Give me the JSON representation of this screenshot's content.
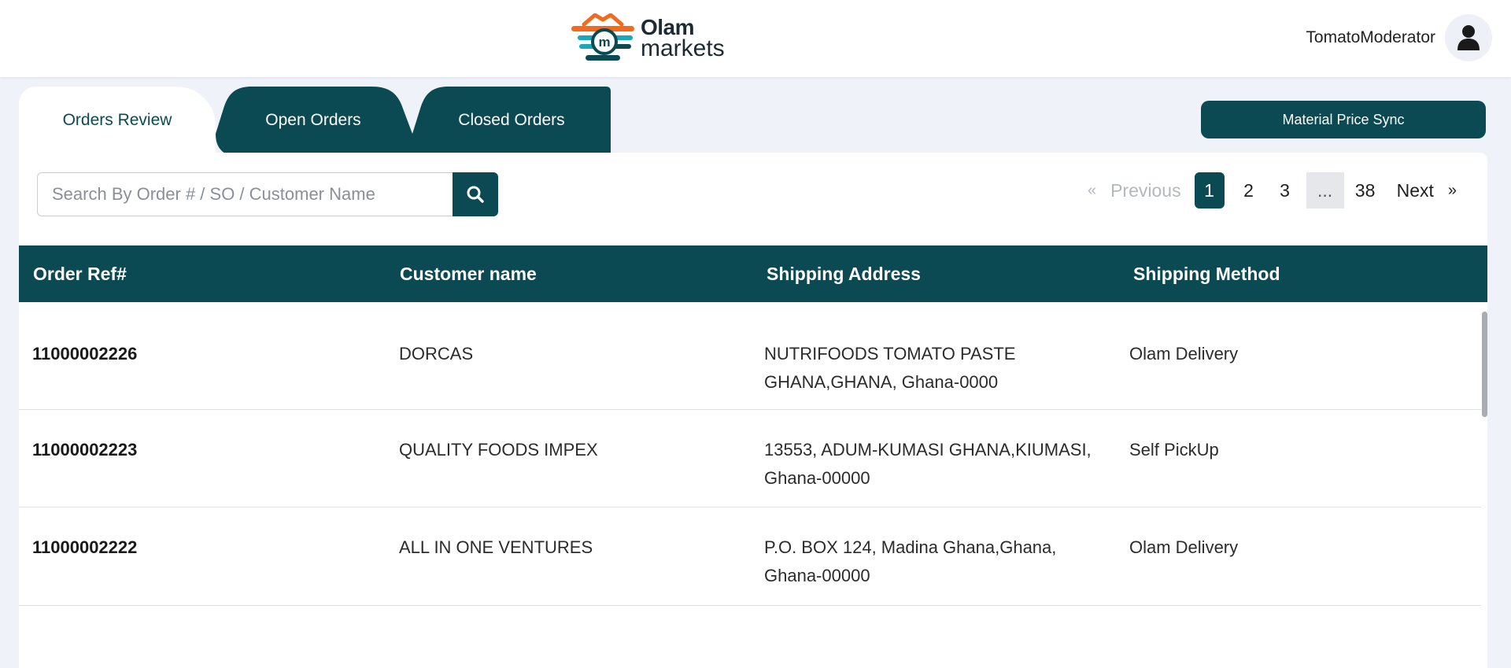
{
  "header": {
    "logo_line1": "Olam",
    "logo_line2": "markets",
    "username": "TomatoModerator"
  },
  "tabs": [
    {
      "label": "Orders Review",
      "active": true
    },
    {
      "label": "Open Orders",
      "active": false
    },
    {
      "label": "Closed Orders",
      "active": false
    }
  ],
  "sync_button": "Material Price Sync",
  "search": {
    "placeholder": "Search By Order # / SO / Customer Name",
    "value": ""
  },
  "pagination": {
    "prev_arrow": "«",
    "previous": "Previous",
    "pages": [
      "1",
      "2",
      "3",
      "...",
      "38"
    ],
    "current": "1",
    "next": "Next",
    "next_arrow": "»"
  },
  "table": {
    "columns": [
      "Order Ref#",
      "Customer name",
      "Shipping Address",
      "Shipping Method"
    ],
    "rows": [
      {
        "order_ref": "11000002226",
        "customer": "DORCAS",
        "address_line1": "NUTRIFOODS TOMATO PASTE",
        "address_line2": "GHANA,GHANA, Ghana-0000",
        "method": "Olam Delivery"
      },
      {
        "order_ref": "11000002223",
        "customer": "QUALITY FOODS IMPEX",
        "address_line1": "13553, ADUM-KUMASI GHANA,KIUMASI,",
        "address_line2": "Ghana-00000",
        "method": "Self PickUp"
      },
      {
        "order_ref": "11000002222",
        "customer": "ALL IN ONE VENTURES",
        "address_line1": "P.O. BOX 124, Madina Ghana,Ghana,",
        "address_line2": "Ghana-00000",
        "method": "Olam Delivery"
      }
    ]
  },
  "colors": {
    "primary": "#0b4a52",
    "background": "#f0f2f9",
    "logo_orange": "#f26a1b",
    "logo_teal": "#1aa7b8"
  },
  "icons": {
    "search_button": "search-icon",
    "avatar": "user-icon"
  }
}
